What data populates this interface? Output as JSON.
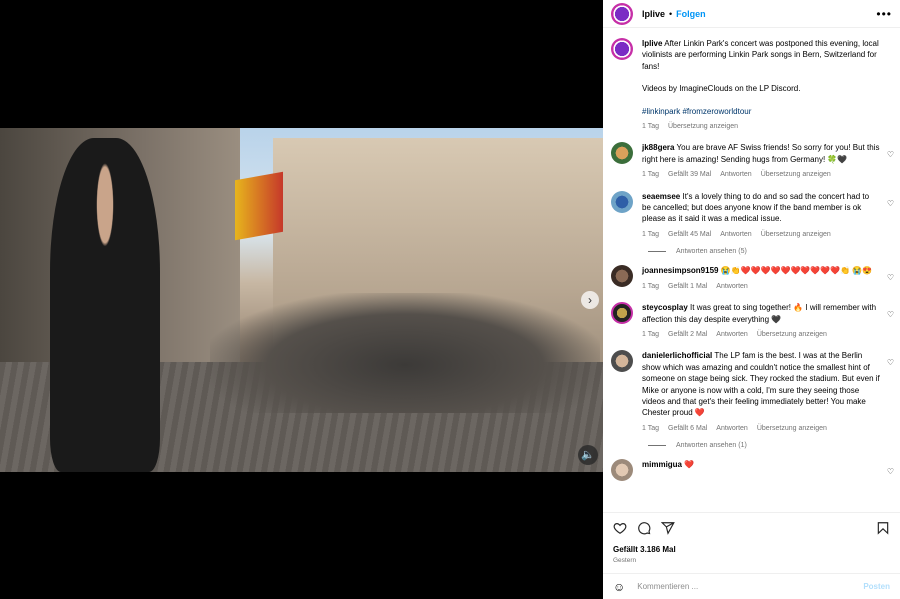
{
  "post": {
    "username": "lplive",
    "follow_label": "Folgen",
    "dot": "•",
    "more_label": "•••"
  },
  "caption": {
    "username": "lplive",
    "text": "After Linkin Park's concert was postponed this evening, local violinists are performing Linkin Park songs in Bern, Switzerland for fans!",
    "credit": "Videos by ImagineClouds on the LP Discord.",
    "hashtags": "#linkinpark #fromzeroworldtour",
    "time": "1 Tag",
    "translate": "Übersetzung anzeigen"
  },
  "comments": [
    {
      "username": "jk88gera",
      "text": "You are brave AF Swiss friends! So sorry for you! But this right here is amazing! Sending hugs from Germany! 🍀🖤",
      "time": "1 Tag",
      "likes": "Gefällt 39 Mal",
      "reply": "Antworten",
      "translate": "Übersetzung anzeigen",
      "replies": ""
    },
    {
      "username": "seaemsee",
      "text": "It's a lovely thing to do and so sad the concert had to be cancelled; but does anyone know if the band member is ok please as it said it was a medical issue.",
      "time": "1 Tag",
      "likes": "Gefällt 45 Mal",
      "reply": "Antworten",
      "translate": "Übersetzung anzeigen",
      "replies": "Antworten ansehen (5)"
    },
    {
      "username": "joannesimpson9159",
      "text": "😭👏❤️❤️❤️❤️❤️❤️❤️❤️❤️❤️👏 😭😍",
      "time": "1 Tag",
      "likes": "Gefällt 1 Mal",
      "reply": "Antworten",
      "translate": "",
      "replies": ""
    },
    {
      "username": "steycosplay",
      "text": "It was great to sing together! 🔥 I will remember with affection this day despite everything 🖤",
      "time": "1 Tag",
      "likes": "Gefällt 2 Mal",
      "reply": "Antworten",
      "translate": "Übersetzung anzeigen",
      "replies": ""
    },
    {
      "username": "danielerlichofficial",
      "text": "The LP fam is the best. I was at the Berlin show which was amazing and couldn't notice the smallest hint of someone on stage being sick. They rocked the stadium. But even if Mike or anyone is now with a cold, I'm sure they seeing those videos and that get's their feeling immediately better! You make Chester proud ❤️",
      "time": "1 Tag",
      "likes": "Gefällt 6 Mal",
      "reply": "Antworten",
      "translate": "Übersetzung anzeigen",
      "replies": "Antworten ansehen (1)"
    },
    {
      "username": "mimmigua",
      "text": "❤️",
      "time": "",
      "likes": "",
      "reply": "",
      "translate": "",
      "replies": ""
    }
  ],
  "footer": {
    "likes": "Gefällt 3.186 Mal",
    "date": "Gestern",
    "comment_placeholder": "Kommentieren ...",
    "post_label": "Posten",
    "emoji": "☺"
  },
  "media": {
    "next": "›",
    "volume": "🔈"
  },
  "icons": {
    "heart": "heart-icon",
    "comment": "comment-icon",
    "share": "share-icon",
    "save": "bookmark-icon"
  }
}
